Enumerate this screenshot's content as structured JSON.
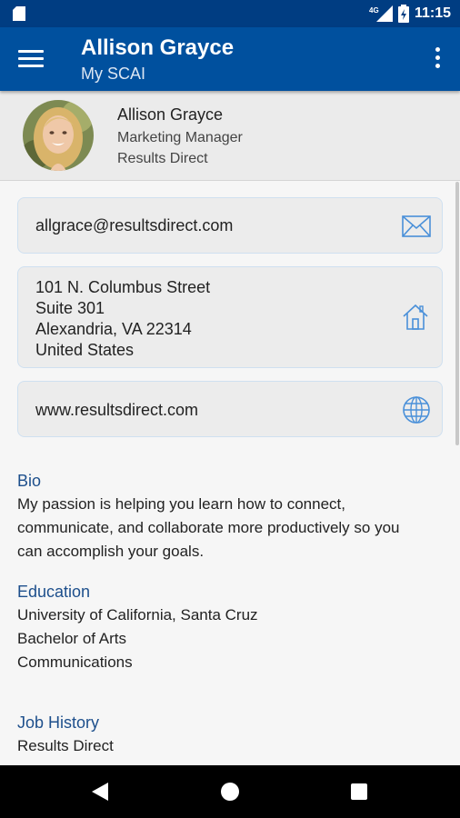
{
  "status": {
    "time": "11:15",
    "network": "4G"
  },
  "appbar": {
    "title": "Allison Grayce",
    "subtitle": "My SCAI"
  },
  "profile": {
    "name": "Allison Grayce",
    "job_title": "Marketing Manager",
    "company": "Results Direct"
  },
  "contact": {
    "email": "allgrace@resultsdirect.com",
    "address_lines": [
      "101 N. Columbus Street",
      "Suite 301",
      "Alexandria, VA 22314",
      "United States"
    ],
    "website": "www.resultsdirect.com"
  },
  "bio": {
    "heading": "Bio",
    "lines": [
      "My passion is helping you learn how to connect,",
      "communicate, and collaborate more productively so you",
      "can accomplish your goals."
    ]
  },
  "education": {
    "heading": "Education",
    "lines": [
      "University of California, Santa Cruz",
      "Bachelor of Arts",
      "Communications"
    ]
  },
  "job_history": {
    "heading": "Job History",
    "lines": [
      "Results Direct"
    ]
  },
  "colors": {
    "status_bar": "#003d82",
    "app_bar": "#00509e",
    "accent": "#1d4f8c",
    "icon": "#4a90d9"
  },
  "icons": [
    "sd-card-icon",
    "signal-icon",
    "battery-icon",
    "menu-icon",
    "more-vert-icon",
    "mail-icon",
    "home-icon",
    "globe-icon"
  ]
}
